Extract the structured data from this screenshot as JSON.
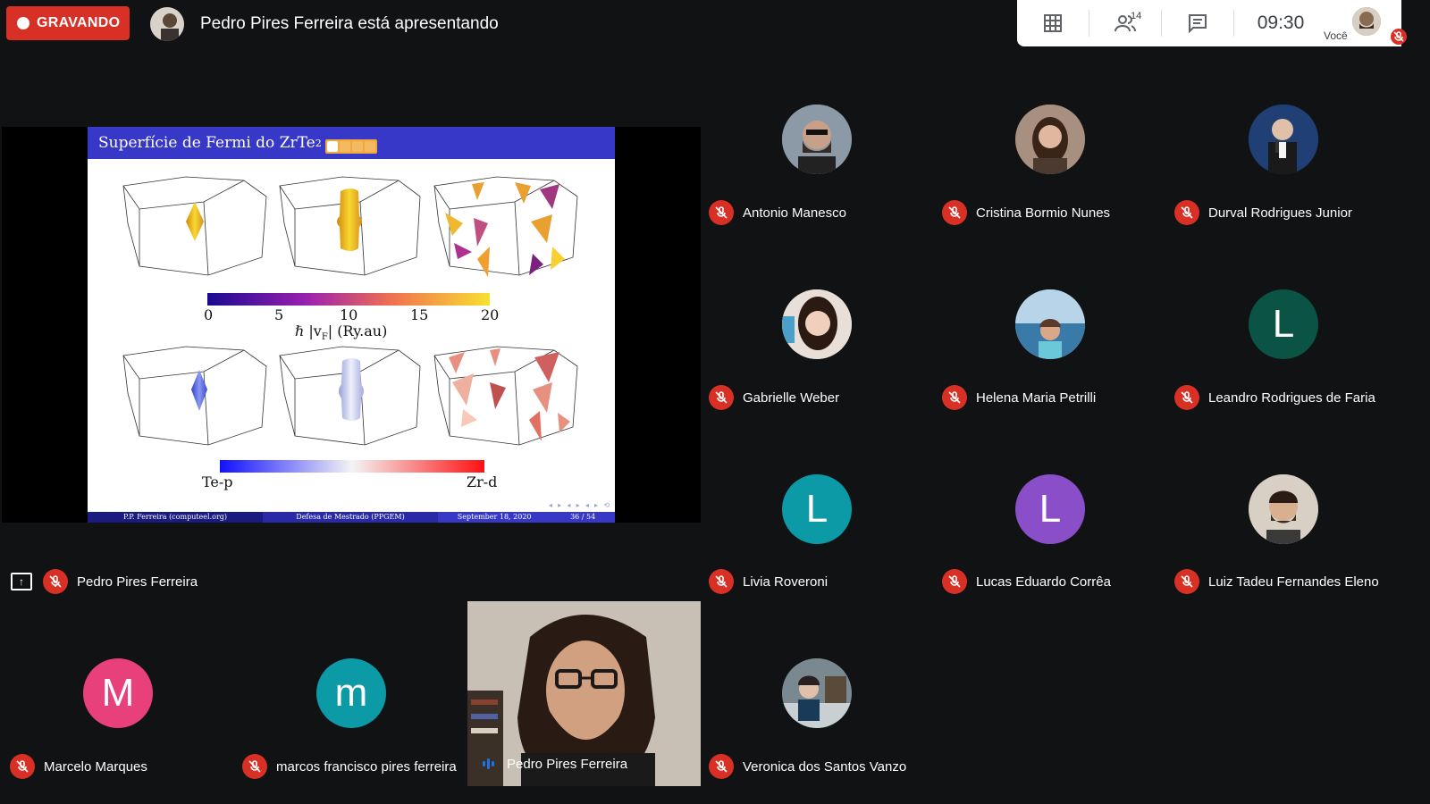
{
  "recording": {
    "label": "GRAVANDO",
    "color": "#d93025"
  },
  "presenter_banner": {
    "text": "Pedro Pires Ferreira está apresentando"
  },
  "top_panel": {
    "participants_count": "14",
    "clock": "09:30",
    "self_label": "Você",
    "icons": [
      "grid-icon",
      "people-icon",
      "chat-icon"
    ]
  },
  "presentation": {
    "owner_name": "Pedro Pires Ferreira",
    "slide": {
      "title": "Superfície de Fermi do ZrTe",
      "title_sub": "2",
      "colorbar1_ticks": [
        "0",
        "5",
        "10",
        "15",
        "20"
      ],
      "colorbar1_label": "ℏ |v",
      "colorbar1_label_sub": "F",
      "colorbar1_label_unit": "|  (Ry.au)",
      "colorbar2_left": "Te-p",
      "colorbar2_right": "Zr-d",
      "footer_author": "P.P. Ferreira  (computeel.org)",
      "footer_event": "Defesa de Mestrado (PPGEM)",
      "footer_date": "September 18, 2020",
      "footer_page": "36 / 54"
    }
  },
  "participants": [
    {
      "name": "Antonio Manesco",
      "initial": "",
      "color": "#6d7a86"
    },
    {
      "name": "Cristina Bormio Nunes",
      "initial": "",
      "color": "#6e5448"
    },
    {
      "name": "Durval Rodrigues Junior",
      "initial": "",
      "color": "#1f3f75"
    },
    {
      "name": "Gabrielle Weber",
      "initial": "",
      "color": "#c9b8a8"
    },
    {
      "name": "Helena Maria Petrilli",
      "initial": "",
      "color": "#4f8fb2"
    },
    {
      "name": "Leandro Rodrigues de Faria",
      "initial": "L",
      "color": "#0b5345"
    },
    {
      "name": "Livia Roveroni",
      "initial": "L",
      "color": "#0b9aa6"
    },
    {
      "name": "Lucas Eduardo Corrêa",
      "initial": "L",
      "color": "#8a4fc8"
    },
    {
      "name": "Luiz Tadeu Fernandes Eleno",
      "initial": "",
      "color": "#7a6654"
    },
    {
      "name": "Marcelo Marques",
      "initial": "M",
      "color": "#e8407a"
    },
    {
      "name": "marcos francisco pires ferreira",
      "initial": "m",
      "color": "#0b9aa6"
    },
    {
      "name": "Pedro Pires Ferreira",
      "initial": "",
      "color": "#2a2522"
    },
    {
      "name": "Veronica dos Santos Vanzo",
      "initial": "",
      "color": "#4a5560"
    }
  ]
}
